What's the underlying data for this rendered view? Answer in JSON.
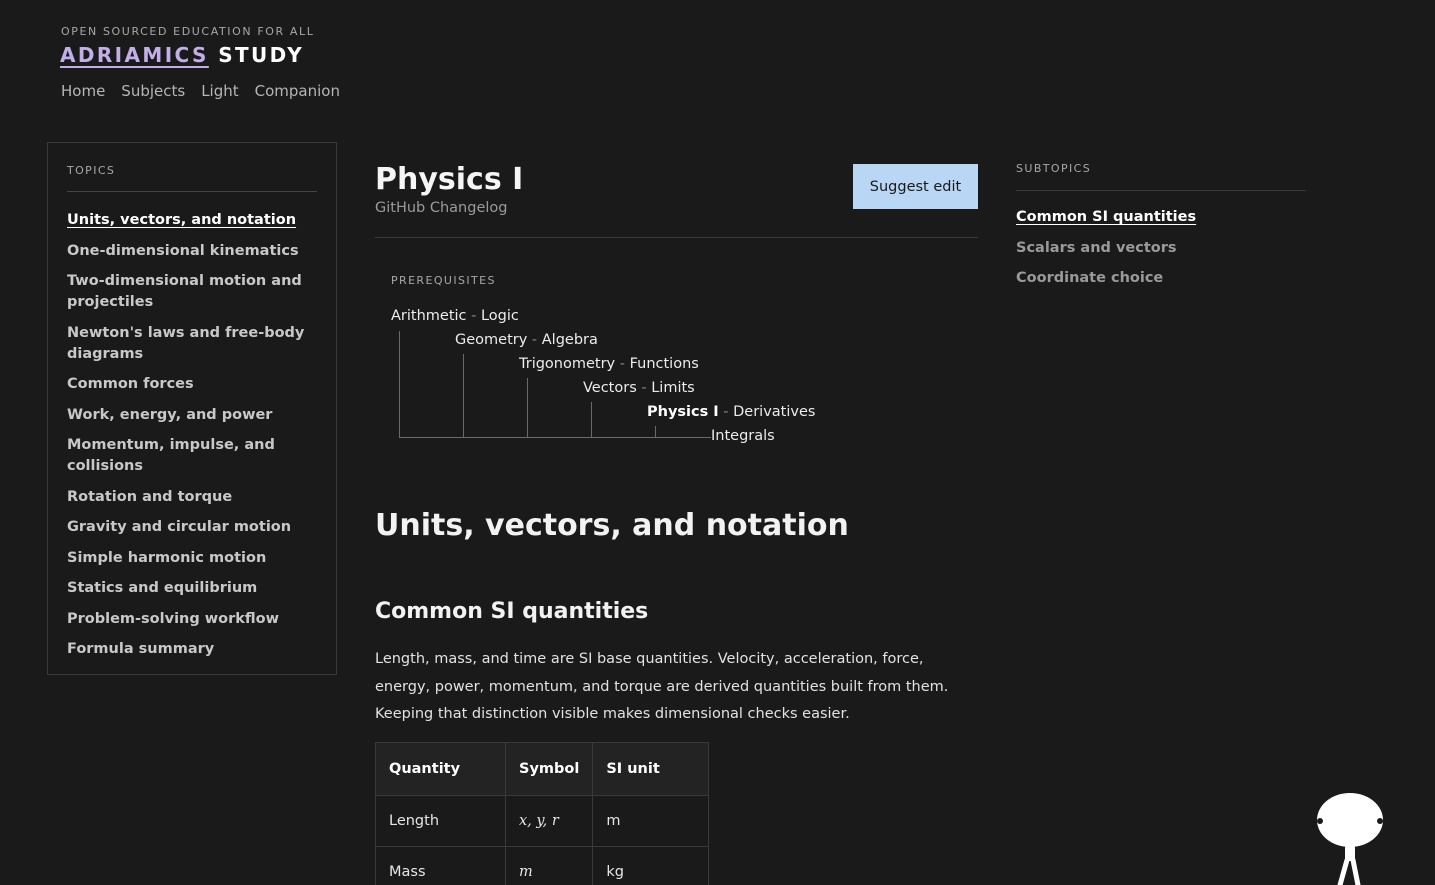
{
  "header": {
    "tagline": "OPEN SOURCED EDUCATION FOR ALL",
    "brand_part1": "ADRIAMICS",
    "brand_part2": "STUDY",
    "nav": [
      "Home",
      "Subjects",
      "Light",
      "Companion"
    ]
  },
  "topics": {
    "label": "TOPICS",
    "items": [
      "Units, vectors, and notation",
      "One-dimensional kinematics",
      "Two-dimensional motion and projectiles",
      "Newton's laws and free-body diagrams",
      "Common forces",
      "Work, energy, and power",
      "Momentum, impulse, and collisions",
      "Rotation and torque",
      "Gravity and circular motion",
      "Simple harmonic motion",
      "Statics and equilibrium",
      "Problem-solving workflow",
      "Formula summary"
    ],
    "active_index": 0
  },
  "main": {
    "title": "Physics I",
    "changelog": "GitHub Changelog",
    "suggest_label": "Suggest edit",
    "prereq_label": "PREREQUISITES",
    "prereq_rows": [
      {
        "a": "Arithmetic",
        "sep": "-",
        "b": "Logic"
      },
      {
        "a": "Geometry",
        "sep": "-",
        "b": "Algebra"
      },
      {
        "a": "Trigonometry",
        "sep": "-",
        "b": "Functions"
      },
      {
        "a": "Vectors",
        "sep": "-",
        "b": "Limits"
      },
      {
        "a": "Physics I",
        "sep": "-",
        "b": "Derivatives"
      }
    ],
    "prereq_last": "Integrals",
    "section_title": "Units, vectors, and notation",
    "subsection_title": "Common SI quantities",
    "paragraph": "Length, mass, and time are SI base quantities. Velocity, acceleration, force, energy, power, momentum, and torque are derived quantities built from them. Keeping that distinction visible makes dimensional checks easier.",
    "table": {
      "headers": [
        "Quantity",
        "Symbol",
        "SI unit"
      ],
      "rows": [
        [
          "Length",
          "x, y, r",
          "m"
        ],
        [
          "Mass",
          "m",
          "kg"
        ]
      ]
    }
  },
  "subtopics": {
    "label": "SUBTOPICS",
    "items": [
      "Common SI quantities",
      "Scalars and vectors",
      "Coordinate choice"
    ],
    "active_index": 0
  },
  "colors": {
    "background": "#1a1a1b",
    "brand_accent": "#c4aee8",
    "button_bg": "#b9d7f5"
  },
  "icons": {
    "mascot": "mascot-figure-icon"
  }
}
